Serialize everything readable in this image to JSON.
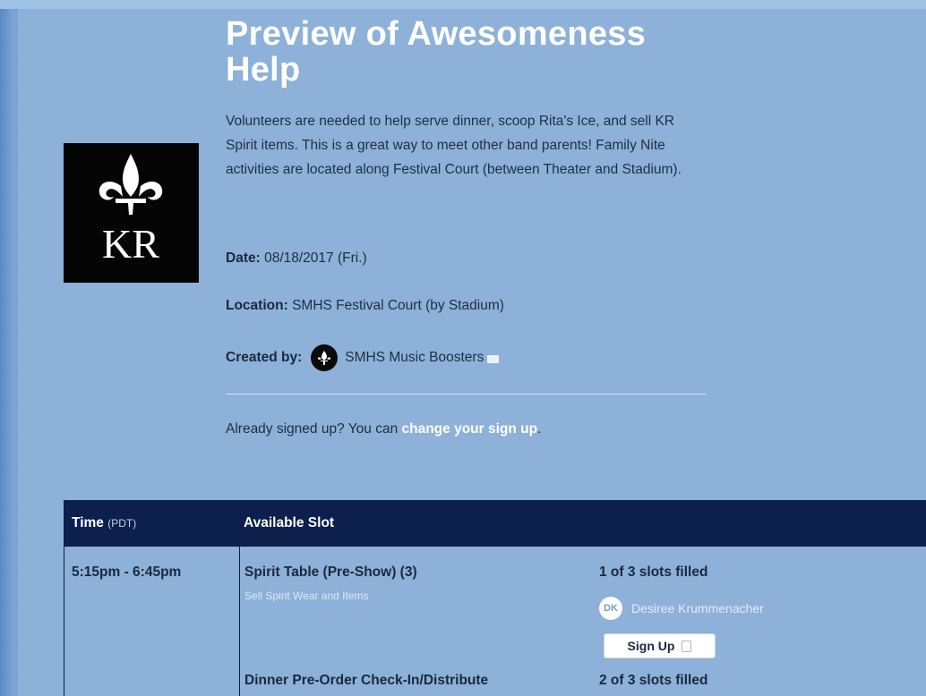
{
  "event": {
    "title": "Preview of Awesomeness Help",
    "description": "Volunteers are needed to help serve dinner, scoop Rita's Ice, and sell KR Spirit items. This is a great way to meet other band parents! Family Nite activities are located along Festival Court (between Theater and Stadium).",
    "logo_text": "KR",
    "date_label": "Date:",
    "date_value": "08/18/2017 (Fri.)",
    "location_label": "Location:",
    "location_value": "SMHS Festival Court (by Stadium)",
    "created_by_label": "Created by:",
    "creator_name": "SMHS Music Boosters",
    "creator_icon": "envelope-icon",
    "already_text": "Already signed up? You can",
    "change_link": "change your sign up",
    "already_end": "."
  },
  "table": {
    "time_header": "Time",
    "timezone": "(PDT)",
    "slot_header": "Available Slot",
    "rows": [
      {
        "time": "5:15pm - 6:45pm",
        "slots": [
          {
            "title": "Spirit Table (Pre-Show) (3)",
            "subtitle": "Sell Spirit Wear and Items",
            "filled": "1 of 3 slots filled",
            "volunteer_initials": "DK",
            "volunteer_name": "Desiree Krummenacher",
            "button": "Sign Up"
          },
          {
            "title": "Dinner Pre-Order Check-In/Distribute",
            "filled": "2 of 3 slots filled"
          }
        ]
      }
    ]
  }
}
